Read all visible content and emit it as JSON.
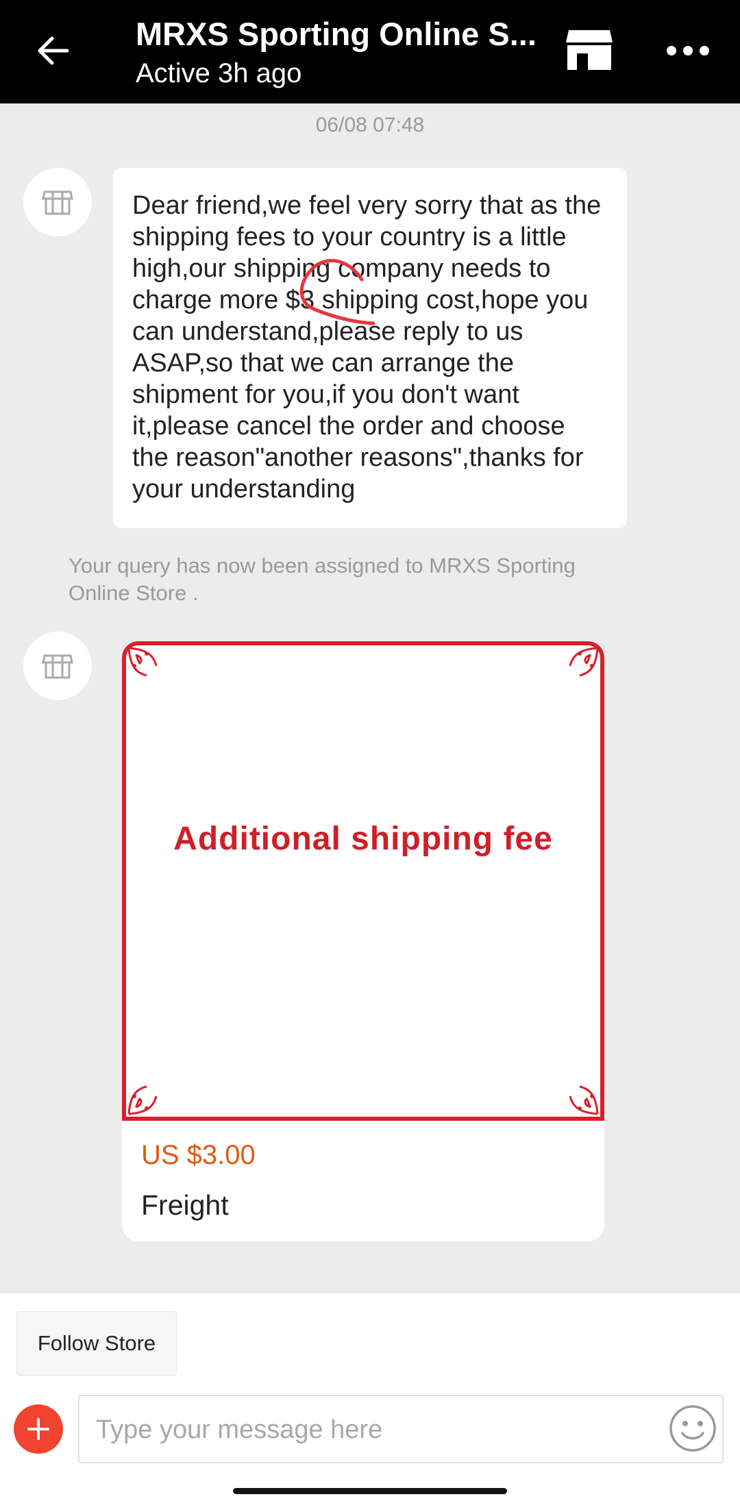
{
  "header": {
    "title": "MRXS Sporting Online S...",
    "status": "Active 3h ago"
  },
  "chat": {
    "timestamp": "06/08 07:48",
    "message_text": "Dear friend,we feel very sorry that as the shipping fees to your country is a little high,our shipping company needs to charge more $3 shipping cost,hope you can understand,please reply to us ASAP,so that we can arrange the shipment for you,if you don't want it,please cancel the order and choose the reason\"another reasons\",thanks for your understanding",
    "system_note": "Your query has now been assigned to MRXS Sporting Online Store .",
    "product": {
      "image_text": "Additional shipping fee",
      "price": "US $3.00",
      "name": "Freight"
    }
  },
  "bottom": {
    "follow_label": "Follow Store",
    "input_placeholder": "Type your message here"
  },
  "colors": {
    "header_bg": "#000000",
    "price": "#e05a12",
    "accent_red": "#f04430",
    "card_border": "#d9202b"
  }
}
